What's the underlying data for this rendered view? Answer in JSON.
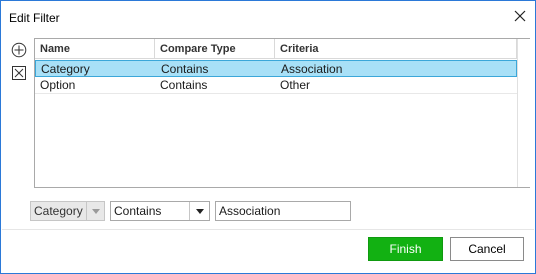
{
  "dialog": {
    "title": "Edit Filter"
  },
  "toolbar": {
    "add_icon": "plus-circle-icon",
    "remove_icon": "x-box-icon"
  },
  "grid": {
    "columns": [
      "Name",
      "Compare Type",
      "Criteria"
    ],
    "rows": [
      {
        "name": "Category",
        "compare": "Contains",
        "criteria": "Association",
        "selected": true
      },
      {
        "name": "Option",
        "compare": "Contains",
        "criteria": "Other",
        "selected": false
      }
    ]
  },
  "editor": {
    "field_value": "Category",
    "compare_value": "Contains",
    "criteria_value": "Association"
  },
  "buttons": {
    "finish": "Finish",
    "cancel": "Cancel"
  },
  "colors": {
    "accent_border": "#2b79d8",
    "selected_row": "#a8e0f7",
    "finish_button": "#12b112"
  }
}
